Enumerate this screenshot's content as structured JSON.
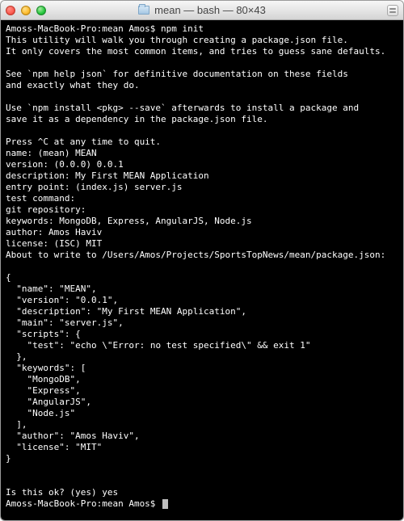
{
  "titlebar": {
    "title": "mean — bash — 80×43"
  },
  "terminal": {
    "prompt_start": "Amoss-MacBook-Pro:mean Amos$ npm init",
    "intro1": "This utility will walk you through creating a package.json file.",
    "intro2": "It only covers the most common items, and tries to guess sane defaults.",
    "see1": "See `npm help json` for definitive documentation on these fields",
    "see2": "and exactly what they do.",
    "use1": "Use `npm install <pkg> --save` afterwards to install a package and",
    "use2": "save it as a dependency in the package.json file.",
    "press": "Press ^C at any time to quit.",
    "q_name": "name: (mean) MEAN",
    "q_version": "version: (0.0.0) 0.0.1",
    "q_description": "description: My First MEAN Application",
    "q_entry": "entry point: (index.js) server.js",
    "q_test": "test command:",
    "q_git": "git repository:",
    "q_keywords": "keywords: MongoDB, Express, AngularJS, Node.js",
    "q_author": "author: Amos Haviv",
    "q_license": "license: (ISC) MIT",
    "about_write": "About to write to /Users/Amos/Projects/SportsTopNews/mean/package.json:",
    "json_open": "{",
    "json_name": "  \"name\": \"MEAN\",",
    "json_version": "  \"version\": \"0.0.1\",",
    "json_description": "  \"description\": \"My First MEAN Application\",",
    "json_main": "  \"main\": \"server.js\",",
    "json_scripts_open": "  \"scripts\": {",
    "json_test": "    \"test\": \"echo \\\"Error: no test specified\\\" && exit 1\"",
    "json_scripts_close": "  },",
    "json_keywords_open": "  \"keywords\": [",
    "json_kw1": "    \"MongoDB\",",
    "json_kw2": "    \"Express\",",
    "json_kw3": "    \"AngularJS\",",
    "json_kw4": "    \"Node.js\"",
    "json_keywords_close": "  ],",
    "json_author": "  \"author\": \"Amos Haviv\",",
    "json_license": "  \"license\": \"MIT\"",
    "json_close": "}",
    "confirm": "Is this ok? (yes) yes",
    "prompt_end": "Amoss-MacBook-Pro:mean Amos$ "
  }
}
